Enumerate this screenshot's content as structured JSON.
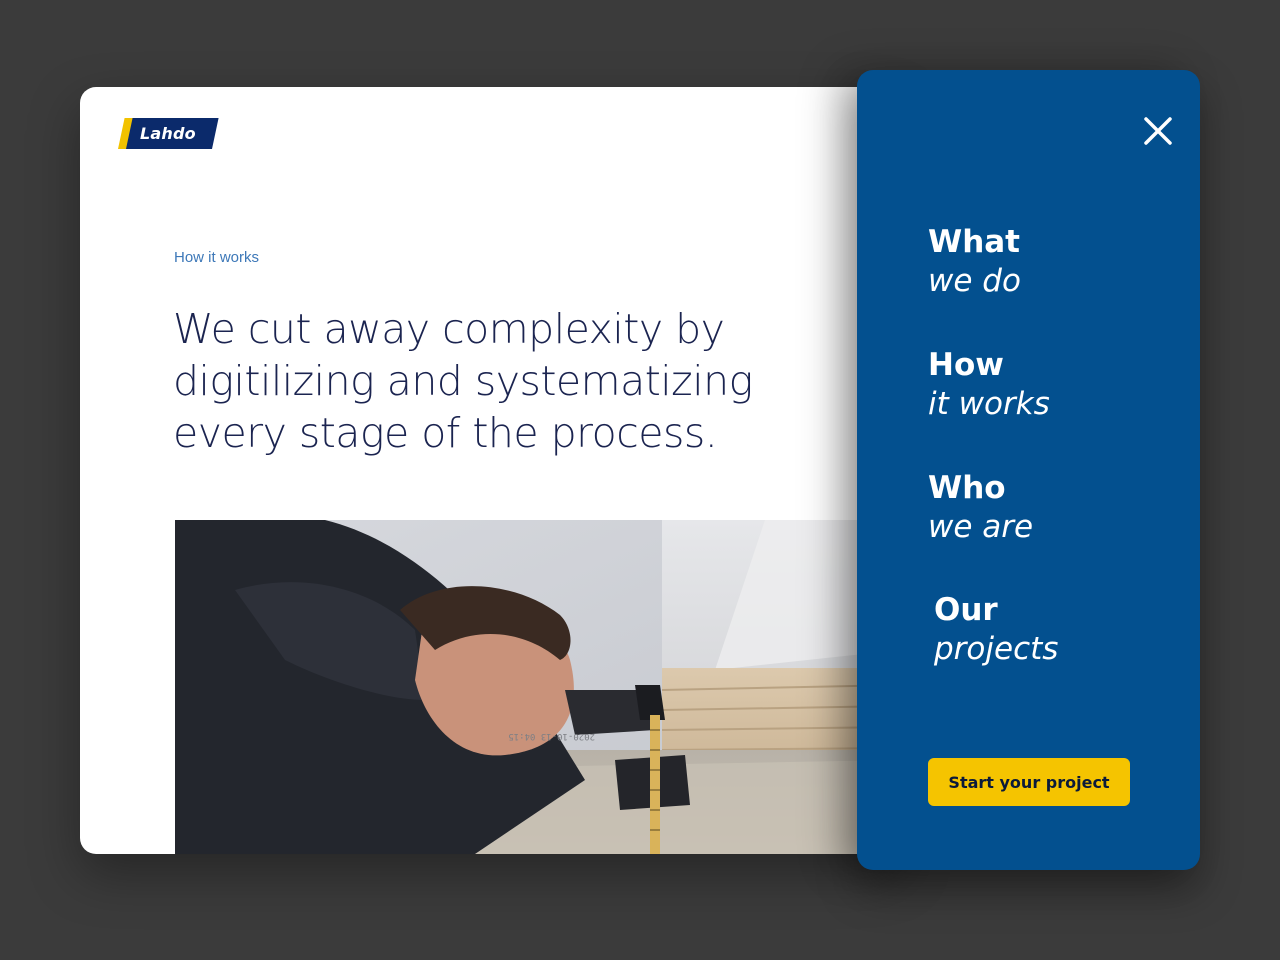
{
  "brand": {
    "logo_text": "Lahdo",
    "colors": {
      "navy": "#0b2a6b",
      "yellow": "#f2c200",
      "menu_blue": "#03508f",
      "heading": "#1b2450",
      "eyebrow": "#3d78b8"
    }
  },
  "main": {
    "eyebrow": "How it works",
    "headline_lines": [
      "We cut away complexity by",
      "digitilizing and systematizing",
      "every stage of the process."
    ],
    "photo": {
      "measuring_tape_print": "2020-10-13  04:15"
    }
  },
  "menu": {
    "close_icon": "close-icon",
    "items": [
      {
        "bold": "What",
        "italic": "we do"
      },
      {
        "bold": "How",
        "italic": "it works"
      },
      {
        "bold": "Who",
        "italic": "we are"
      },
      {
        "bold": "Our",
        "italic": "projects"
      }
    ],
    "cta_label": "Start your project"
  }
}
